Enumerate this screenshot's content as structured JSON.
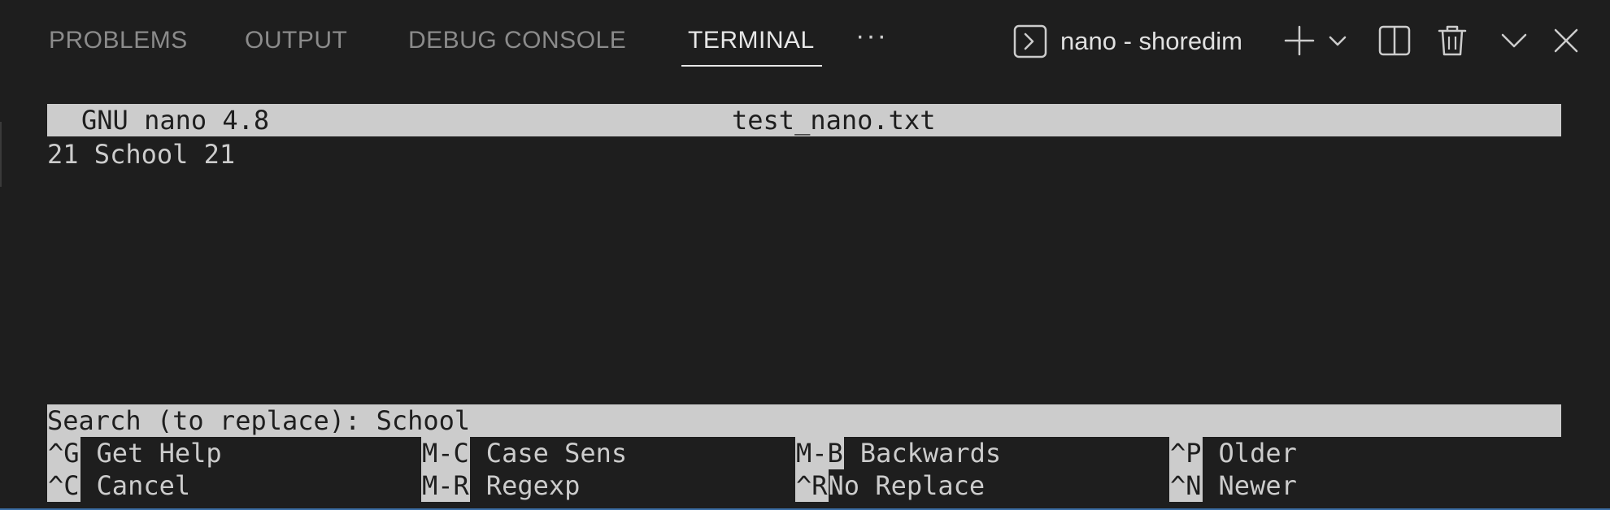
{
  "panel": {
    "tabs": [
      {
        "label": "PROBLEMS",
        "active": false
      },
      {
        "label": "OUTPUT",
        "active": false
      },
      {
        "label": "DEBUG CONSOLE",
        "active": false
      },
      {
        "label": "TERMINAL",
        "active": true
      }
    ],
    "more_label": "···",
    "terminal_name": "nano - shoredim",
    "icons": [
      "terminal-icon",
      "plus-icon",
      "chevron-down-icon",
      "split-icon",
      "trash-icon",
      "chevron-down-icon",
      "close-icon"
    ]
  },
  "nano": {
    "version": "GNU nano 4.8",
    "filename": "test_nano.txt",
    "content_lines": [
      "21 School 21"
    ],
    "prompt": "Search (to replace): School",
    "shortcuts": [
      {
        "key": "^G",
        "label": "Get Help"
      },
      {
        "key": "M-C",
        "label": "Case Sens"
      },
      {
        "key": "M-B",
        "label": "Backwards"
      },
      {
        "key": "^P",
        "label": "Older"
      },
      {
        "key": "^C",
        "label": "Cancel"
      },
      {
        "key": "M-R",
        "label": "Regexp"
      },
      {
        "key": "^R",
        "label": "No Replace"
      },
      {
        "key": "^N",
        "label": "Newer"
      }
    ]
  },
  "colors": {
    "background": "#1e1e1e",
    "inverse_bar": "#cccccc",
    "text": "#cccccc",
    "active_tab": "#e7e7e7",
    "inactive_tab": "#8b8b8b"
  }
}
